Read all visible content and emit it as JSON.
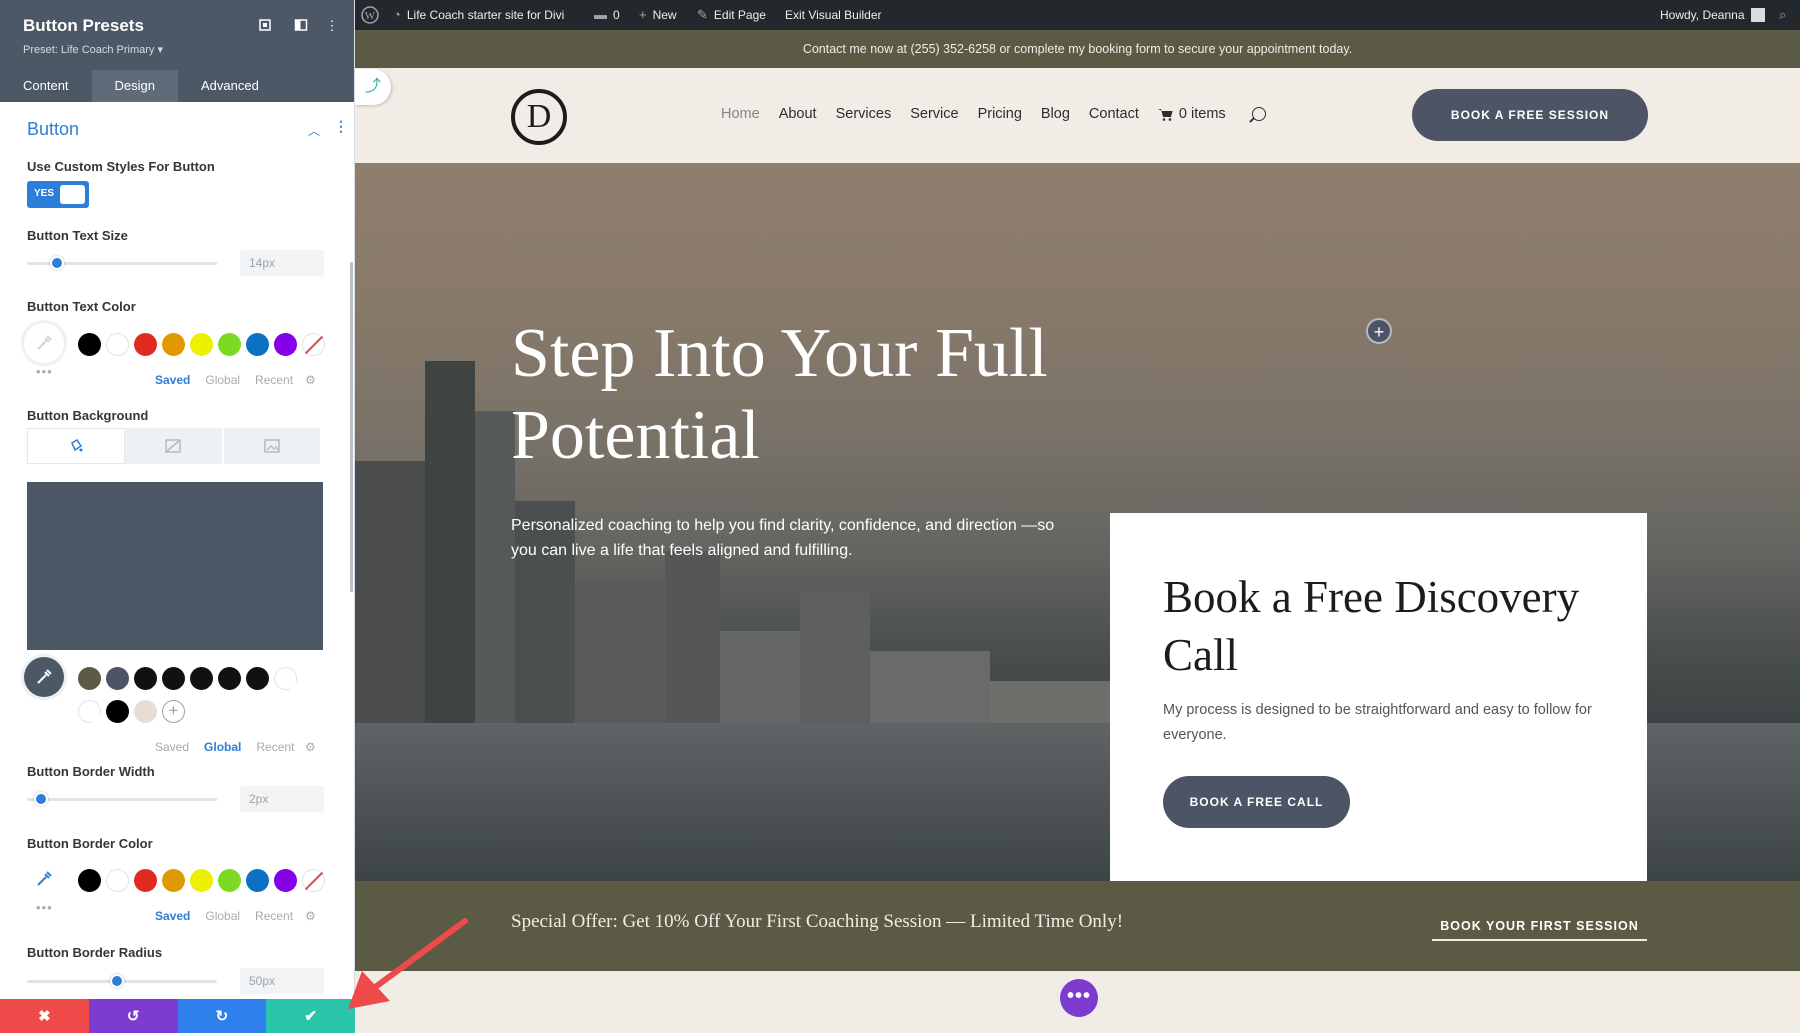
{
  "panel": {
    "title": "Button Presets",
    "preset": "Preset: Life Coach Primary ▾",
    "tabs": [
      {
        "label": "Content",
        "active": false
      },
      {
        "label": "Design",
        "active": true
      },
      {
        "label": "Advanced",
        "active": false
      }
    ],
    "section_title": "Button",
    "use_custom_label": "Use Custom Styles For Button",
    "toggle_label": "YES",
    "toggle_on": true,
    "text_size_label": "Button Text Size",
    "text_size_value": "14px",
    "text_color_label": "Button Text Color",
    "palette_tabs_a": [
      "Saved",
      "Global",
      "Recent"
    ],
    "palette_a_active": "Saved",
    "bg_label": "Button Background",
    "bg_color": "#4c5866",
    "palette_b_active": "Global",
    "border_width_label": "Button Border Width",
    "border_width_value": "2px",
    "border_color_label": "Button Border Color",
    "border_radius_label": "Button Border Radius",
    "border_radius_value": "50px",
    "sliders": {
      "text_size": 0.13,
      "border_width": 0.04,
      "border_radius": 0.47
    },
    "basic_swatches": [
      "#000000",
      "#ffffff",
      "#e02b20",
      "#e09900",
      "#edf000",
      "#7cda24",
      "#0c71c3",
      "#8300e9"
    ],
    "global_swatches": [
      "#5b5a45",
      "#4c5466",
      "#111111",
      "#111111",
      "#111111",
      "#111111",
      "#111111",
      "#ffffff",
      "#ffffff",
      "#000000",
      "#e8ddd4"
    ],
    "actions": [
      {
        "icon": "✖",
        "color": "#ef4a4a",
        "name": "discard"
      },
      {
        "icon": "↺",
        "color": "#7e3bd0",
        "name": "undo"
      },
      {
        "icon": "↻",
        "color": "#2f80ed",
        "name": "redo"
      },
      {
        "icon": "✔",
        "color": "#29c4a9",
        "name": "save"
      }
    ]
  },
  "adminbar": {
    "site": "Life Coach starter site for Divi",
    "comments": "0",
    "new": "New",
    "edit": "Edit Page",
    "exit": "Exit Visual Builder",
    "howdy": "Howdy, Deanna"
  },
  "site": {
    "topbar": "Contact me now at (255) 352-6258 or complete my booking form to secure your appointment today.",
    "logo_letter": "D",
    "nav": [
      "Home",
      "About",
      "Services",
      "Service",
      "Pricing",
      "Blog",
      "Contact"
    ],
    "nav_current": "Home",
    "cart": "0 items",
    "header_cta": "BOOK A FREE SESSION",
    "hero_title": "Step Into Your Full Potential",
    "hero_sub": "Personalized coaching to help you find clarity, confidence, and direction —so you can live a life that feels aligned and fulfilling.",
    "card_title": "Book a Free Discovery Call",
    "card_text": "My process is designed to be straightforward and easy to follow for everyone.",
    "card_cta": "BOOK A FREE CALL",
    "offer_text": "Special Offer: Get 10% Off Your First Coaching Session — Limited Time Only!",
    "offer_cta": "BOOK YOUR FIRST SESSION"
  },
  "colors": {
    "accent": "#2d7ed8",
    "olive": "#5b5a45",
    "slate": "#4c5466",
    "arrow": "#ef4a4a"
  }
}
